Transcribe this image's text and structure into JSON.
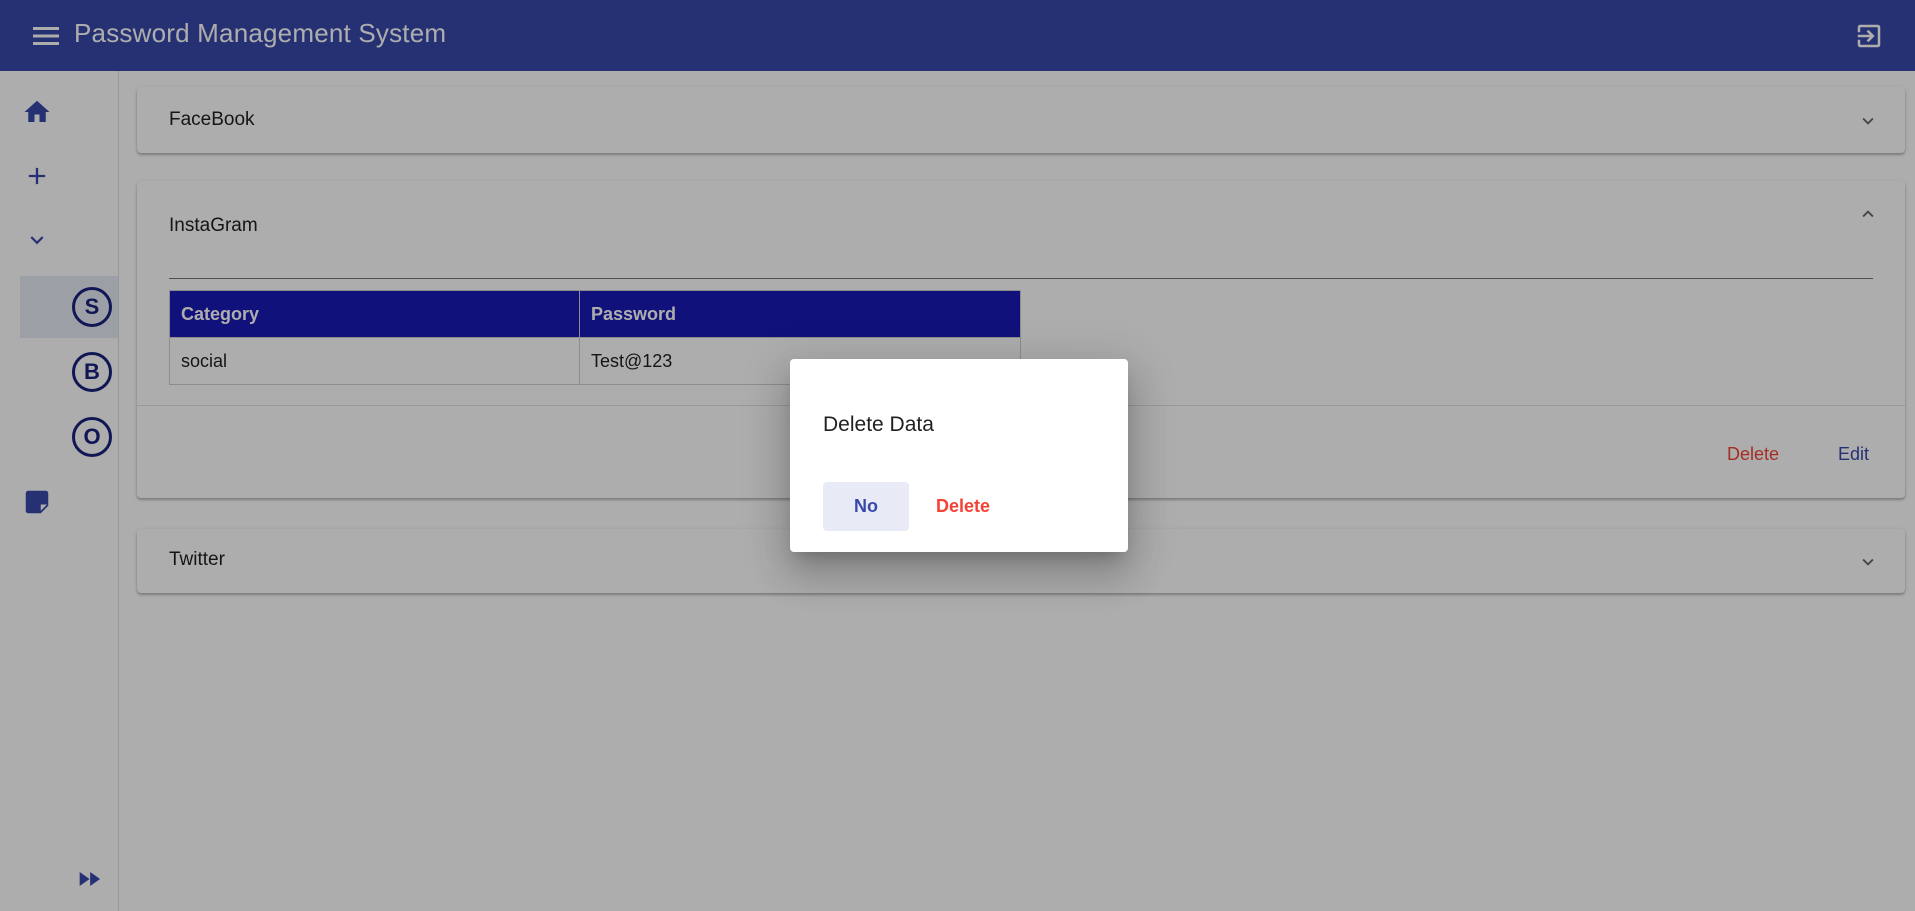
{
  "app": {
    "title": "Password Management System",
    "primary_color": "#3949ab",
    "table_header_color": "#1a1ab5",
    "danger_color": "#f44336",
    "menu_icon": "menu-icon",
    "logout_icon": "logout-icon"
  },
  "sidebar": {
    "items": [
      {
        "icon": "home-icon"
      },
      {
        "icon": "add-icon"
      },
      {
        "icon": "chevron-down-icon"
      },
      {
        "letter": "S",
        "active": true
      },
      {
        "letter": "B"
      },
      {
        "letter": "O"
      },
      {
        "icon": "note-icon"
      }
    ],
    "footer_icon": "fast-forward-icon"
  },
  "panels": [
    {
      "title": "FaceBook",
      "expanded": false
    },
    {
      "title": "InstaGram",
      "expanded": true,
      "table": {
        "headers": [
          "Category",
          "Password"
        ],
        "rows": [
          [
            "social",
            "Test@123"
          ]
        ]
      },
      "actions": {
        "delete_label": "Delete",
        "edit_label": "Edit"
      }
    },
    {
      "title": "Twitter",
      "expanded": false
    }
  ],
  "dialog": {
    "title": "Delete Data",
    "no_label": "No",
    "delete_label": "Delete"
  }
}
